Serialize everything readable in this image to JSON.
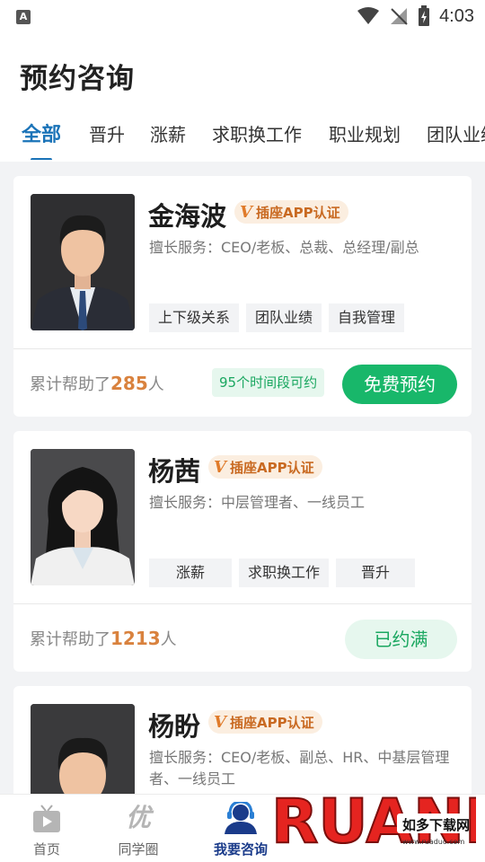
{
  "status_bar": {
    "time": "4:03"
  },
  "header": {
    "title": "预约咨询",
    "tabs": [
      {
        "label": "全部",
        "active": true
      },
      {
        "label": "晋升",
        "active": false
      },
      {
        "label": "涨薪",
        "active": false
      },
      {
        "label": "求职换工作",
        "active": false
      },
      {
        "label": "职业规划",
        "active": false
      },
      {
        "label": "团队业绩",
        "active": false
      }
    ]
  },
  "consultants": [
    {
      "name": "金海波",
      "badge": "插座APP认证",
      "expertise": "擅长服务：CEO/老板、总裁、总经理/副总",
      "tags": [
        "上下级关系",
        "团队业绩",
        "自我管理"
      ],
      "helped_prefix": "累计帮助了",
      "helped_count": "285",
      "helped_suffix": "人",
      "slots": "95个时间段可约",
      "button": "免费预约"
    },
    {
      "name": "杨茜",
      "badge": "插座APP认证",
      "expertise": "擅长服务：中层管理者、一线员工",
      "tags": [
        "涨薪",
        "求职换工作",
        "晋升"
      ],
      "helped_prefix": "累计帮助了",
      "helped_count": "1213",
      "helped_suffix": "人",
      "button": "已约满"
    },
    {
      "name": "杨盼",
      "badge": "插座APP认证",
      "expertise": "擅长服务：CEO/老板、副总、HR、中基层管理者、一线员工"
    }
  ],
  "bottom_nav": [
    {
      "label": "首页",
      "icon": "tv-icon",
      "active": false
    },
    {
      "label": "同学圈",
      "icon": "you-character-icon",
      "active": false,
      "icon_glyph": "优"
    },
    {
      "label": "我要咨询",
      "icon": "headset-person-icon",
      "active": true
    }
  ],
  "watermark": {
    "logo": "RUANDAO",
    "caption": "如多下载网",
    "url": "www.ruaduo.com"
  },
  "colors": {
    "accent_blue": "#1a73b8",
    "green": "#18b76a",
    "badge_orange": "#e07b2a",
    "count_orange": "#d9823e"
  }
}
